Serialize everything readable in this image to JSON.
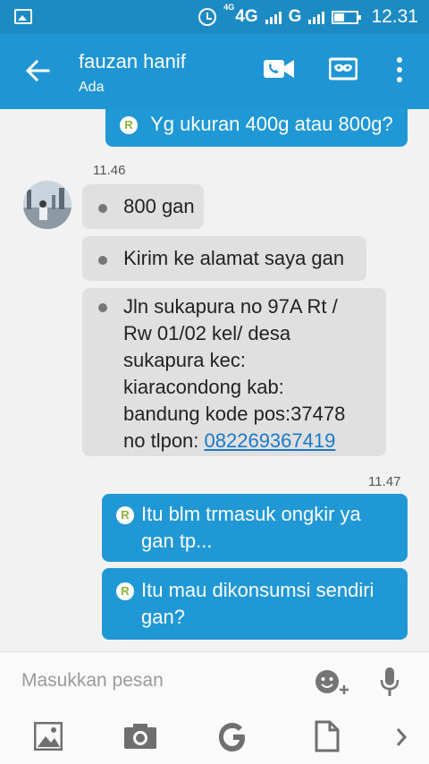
{
  "status_bar": {
    "network_label": "4G",
    "network_small": "4G",
    "second_network": "G",
    "time": "12.31"
  },
  "header": {
    "contact_name": "fauzan hanif",
    "contact_status": "Ada"
  },
  "conversation": {
    "prev_outgoing": {
      "badge": "R",
      "text": "Yg ukuran 400g atau 800g?"
    },
    "incoming_timestamp": "11.46",
    "incoming": [
      {
        "text": "800 gan"
      },
      {
        "text": "Kirim ke alamat saya gan"
      },
      {
        "lines": [
          "Jln sukapura no 97A Rt /",
          "Rw 01/02 kel/ desa",
          "sukapura kec:",
          "kiaracondong kab:",
          "bandung kode pos:37478"
        ],
        "last_prefix": "no tlpon: ",
        "phone": "082269367419"
      }
    ],
    "outgoing_timestamp": "11.47",
    "outgoing": [
      {
        "badge": "R",
        "line1": "Itu blm trmasuk ongkir ya",
        "line2": "gan tp..."
      },
      {
        "badge": "R",
        "line1": "Itu mau dikonsumsi sendiri",
        "line2": "gan?"
      }
    ]
  },
  "composer": {
    "placeholder": "Masukkan pesan"
  }
}
